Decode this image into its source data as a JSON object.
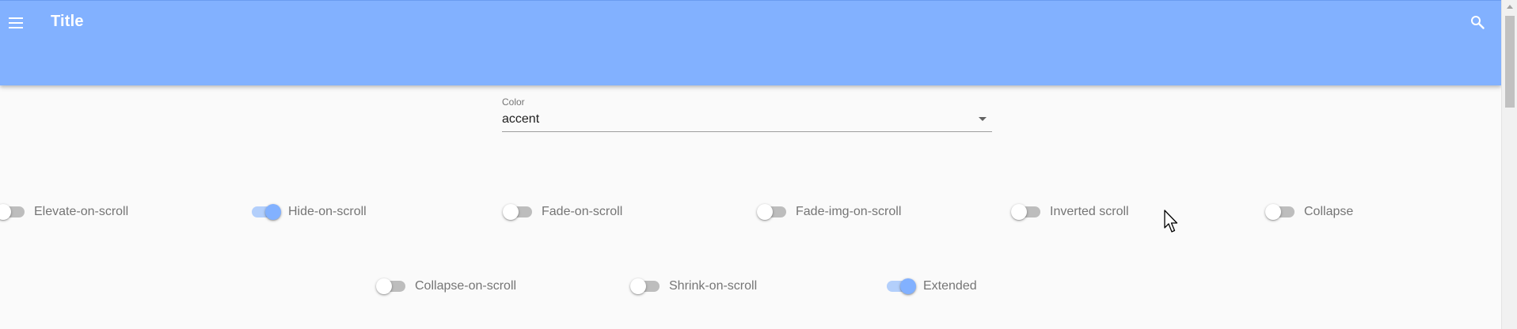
{
  "app_bar": {
    "title": "Title",
    "color": "#82b1ff",
    "menu_icon": "menu-icon",
    "search_icon": "search-icon"
  },
  "color_select": {
    "label": "Color",
    "value": "accent"
  },
  "switches": [
    {
      "label": "Elevate-on-scroll",
      "on": false
    },
    {
      "label": "Hide-on-scroll",
      "on": true
    },
    {
      "label": "Fade-on-scroll",
      "on": false
    },
    {
      "label": "Fade-img-on-scroll",
      "on": false
    },
    {
      "label": "Inverted scroll",
      "on": false
    },
    {
      "label": "Collapse",
      "on": false
    },
    {
      "label": "Collapse-on-scroll",
      "on": false
    },
    {
      "label": "Shrink-on-scroll",
      "on": false
    },
    {
      "label": "Extended",
      "on": true
    }
  ],
  "colors": {
    "accent": "#82b1ff",
    "switch_off_track": "#bdbdbd",
    "label_text": "#757575"
  }
}
